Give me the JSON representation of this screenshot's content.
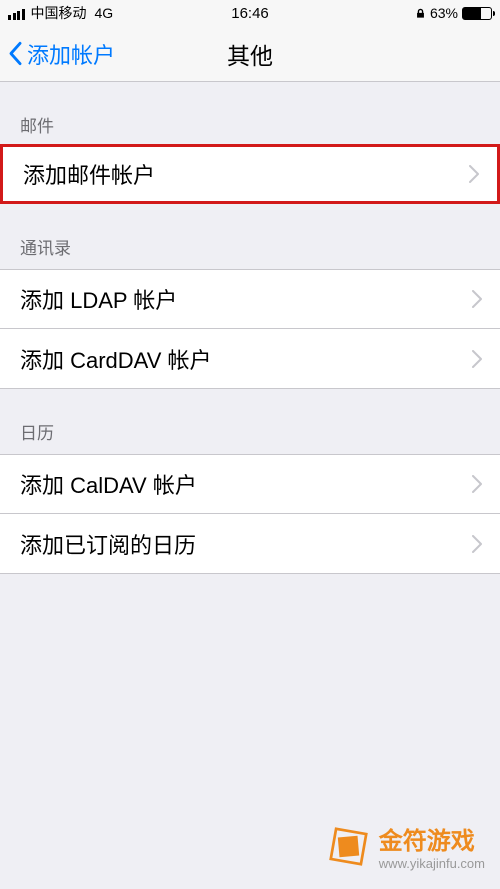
{
  "status": {
    "carrier": "中国移动",
    "network": "4G",
    "time": "16:46",
    "battery_pct": "63%"
  },
  "nav": {
    "back_label": "添加帐户",
    "title": "其他"
  },
  "sections": {
    "mail": {
      "header": "邮件",
      "items": {
        "add_mail": "添加邮件帐户"
      }
    },
    "contacts": {
      "header": "通讯录",
      "items": {
        "add_ldap": "添加 LDAP 帐户",
        "add_carddav": "添加 CardDAV 帐户"
      }
    },
    "calendar": {
      "header": "日历",
      "items": {
        "add_caldav": "添加 CalDAV 帐户",
        "add_subscribed": "添加已订阅的日历"
      }
    }
  },
  "watermark": {
    "title": "金符游戏",
    "url": "www.yikajinfu.com"
  }
}
